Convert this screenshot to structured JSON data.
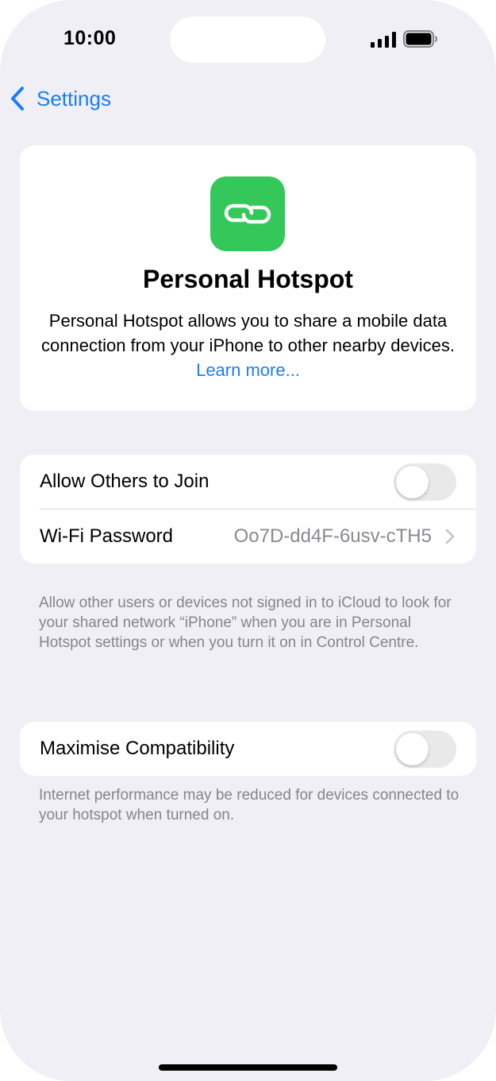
{
  "status_bar": {
    "time": "10:00",
    "signal_icon": "cellular-signal-icon",
    "battery_icon": "battery-icon"
  },
  "nav": {
    "back_label": "Settings",
    "back_icon": "chevron-left-icon"
  },
  "header": {
    "icon": "link-icon",
    "icon_color": "#34c759",
    "title": "Personal Hotspot",
    "description": "Personal Hotspot allows you to share a mobile data connection from your iPhone to other nearby devices.",
    "link": "Learn more..."
  },
  "group1": {
    "allow_others": {
      "label": "Allow Others to Join",
      "enabled": false
    },
    "wifi_password": {
      "label": "Wi-Fi Password",
      "value": "Oo7D-dd4F-6usv-cTH5"
    },
    "footnote": "Allow other users or devices not signed in to iCloud to look for your shared network “iPhone” when you are in Personal Hotspot settings or when you turn it on in Control Centre."
  },
  "group2": {
    "maximise": {
      "label": "Maximise Compatibility",
      "enabled": false
    },
    "footnote": "Internet performance may be reduced for devices connected to your hotspot when turned on."
  },
  "colors": {
    "accent": "#1a7ef5",
    "background": "#f0eff5",
    "toggle_off": "#e9e9ea"
  }
}
